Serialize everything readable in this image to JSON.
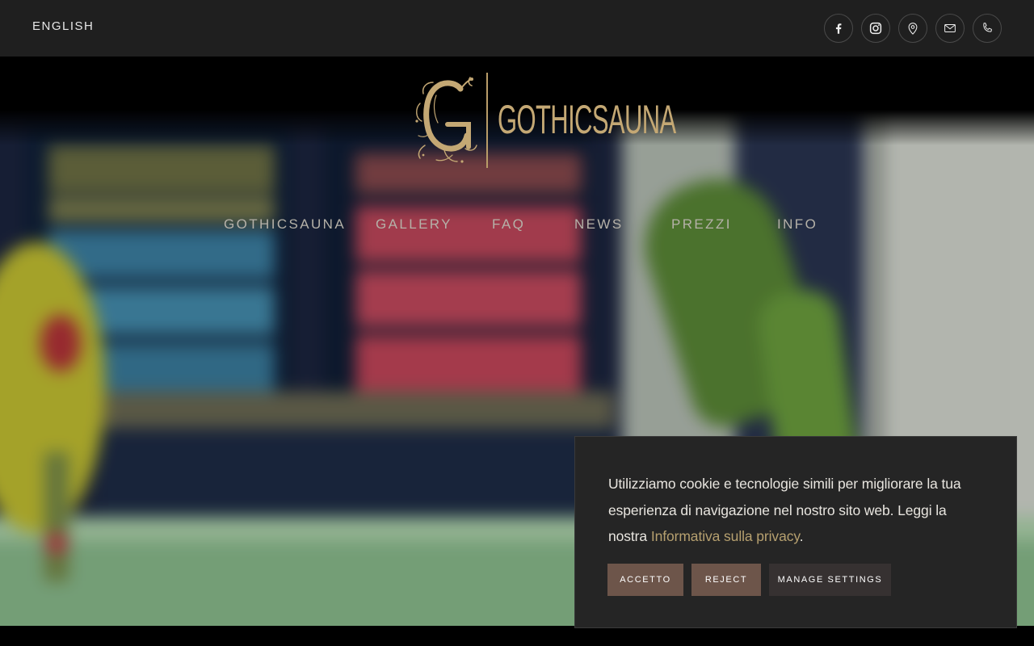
{
  "topbar": {
    "language_label": "ENGLISH",
    "social_icons": [
      "facebook-icon",
      "instagram-icon",
      "map-pin-icon",
      "mail-icon",
      "phone-icon"
    ]
  },
  "logo": {
    "wordmark": "GOTHICSAUNA",
    "accent_color": "#c4a874"
  },
  "nav": {
    "items": [
      "GOTHICSAUNA",
      "GALLERY",
      "FAQ",
      "NEWS",
      "PREZZI",
      "INFO"
    ]
  },
  "cookie": {
    "text_before": "Utilizziamo cookie e tecnologie simili per migliorare la tua esperienza di navigazione nel nostro sito web. Leggi la nostra",
    "privacy_link": "Informativa sulla privacy",
    "text_after": ".",
    "accept_label": "ACCETTO",
    "reject_label": "REJECT",
    "manage_label": "MANAGE SETTINGS",
    "button_color": "#6d554a",
    "link_color": "#b6a06f"
  }
}
